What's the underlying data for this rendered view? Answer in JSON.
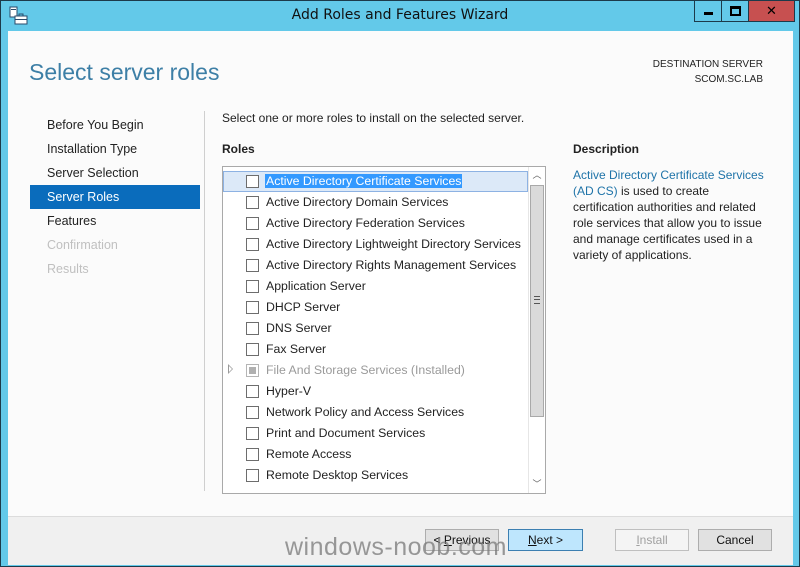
{
  "window": {
    "title": "Add Roles and Features Wizard",
    "controls": {
      "minimize": "—",
      "maximize": "□",
      "close": "✕"
    }
  },
  "header": {
    "page_title": "Select server roles",
    "destination_label": "DESTINATION SERVER",
    "destination_server": "SCOM.SC.LAB"
  },
  "nav": {
    "items": [
      {
        "label": "Before You Begin",
        "state": "normal"
      },
      {
        "label": "Installation Type",
        "state": "normal"
      },
      {
        "label": "Server Selection",
        "state": "normal"
      },
      {
        "label": "Server Roles",
        "state": "active"
      },
      {
        "label": "Features",
        "state": "normal"
      },
      {
        "label": "Confirmation",
        "state": "disabled"
      },
      {
        "label": "Results",
        "state": "disabled"
      }
    ]
  },
  "main": {
    "instruction": "Select one or more roles to install on the selected server.",
    "roles_header": "Roles",
    "roles": [
      {
        "label": "Active Directory Certificate Services",
        "checked": false,
        "selected": true,
        "disabled": false,
        "expandable": false
      },
      {
        "label": "Active Directory Domain Services",
        "checked": false,
        "selected": false,
        "disabled": false,
        "expandable": false
      },
      {
        "label": "Active Directory Federation Services",
        "checked": false,
        "selected": false,
        "disabled": false,
        "expandable": false
      },
      {
        "label": "Active Directory Lightweight Directory Services",
        "checked": false,
        "selected": false,
        "disabled": false,
        "expandable": false
      },
      {
        "label": "Active Directory Rights Management Services",
        "checked": false,
        "selected": false,
        "disabled": false,
        "expandable": false
      },
      {
        "label": "Application Server",
        "checked": false,
        "selected": false,
        "disabled": false,
        "expandable": false
      },
      {
        "label": "DHCP Server",
        "checked": false,
        "selected": false,
        "disabled": false,
        "expandable": false
      },
      {
        "label": "DNS Server",
        "checked": false,
        "selected": false,
        "disabled": false,
        "expandable": false
      },
      {
        "label": "Fax Server",
        "checked": false,
        "selected": false,
        "disabled": false,
        "expandable": false
      },
      {
        "label": "File And Storage Services (Installed)",
        "checked": "indeterminate",
        "selected": false,
        "disabled": true,
        "expandable": true
      },
      {
        "label": "Hyper-V",
        "checked": false,
        "selected": false,
        "disabled": false,
        "expandable": false
      },
      {
        "label": "Network Policy and Access Services",
        "checked": false,
        "selected": false,
        "disabled": false,
        "expandable": false
      },
      {
        "label": "Print and Document Services",
        "checked": false,
        "selected": false,
        "disabled": false,
        "expandable": false
      },
      {
        "label": "Remote Access",
        "checked": false,
        "selected": false,
        "disabled": false,
        "expandable": false
      },
      {
        "label": "Remote Desktop Services",
        "checked": false,
        "selected": false,
        "disabled": false,
        "expandable": false
      }
    ],
    "scroll_position_fraction": 0.0
  },
  "description": {
    "header": "Description",
    "link_text": "Active Directory Certificate Services (AD CS)",
    "body": " is used to create certification authorities and related role services that allow you to issue and manage certificates used in a variety of applications."
  },
  "footer": {
    "previous": {
      "prefix": "< ",
      "mnemonic": "P",
      "rest": "revious"
    },
    "next": {
      "prefix": "",
      "mnemonic": "N",
      "rest": "ext >"
    },
    "install": {
      "prefix": "",
      "mnemonic": "I",
      "rest": "nstall"
    },
    "cancel": "Cancel"
  },
  "watermark": "windows-noob.com"
}
